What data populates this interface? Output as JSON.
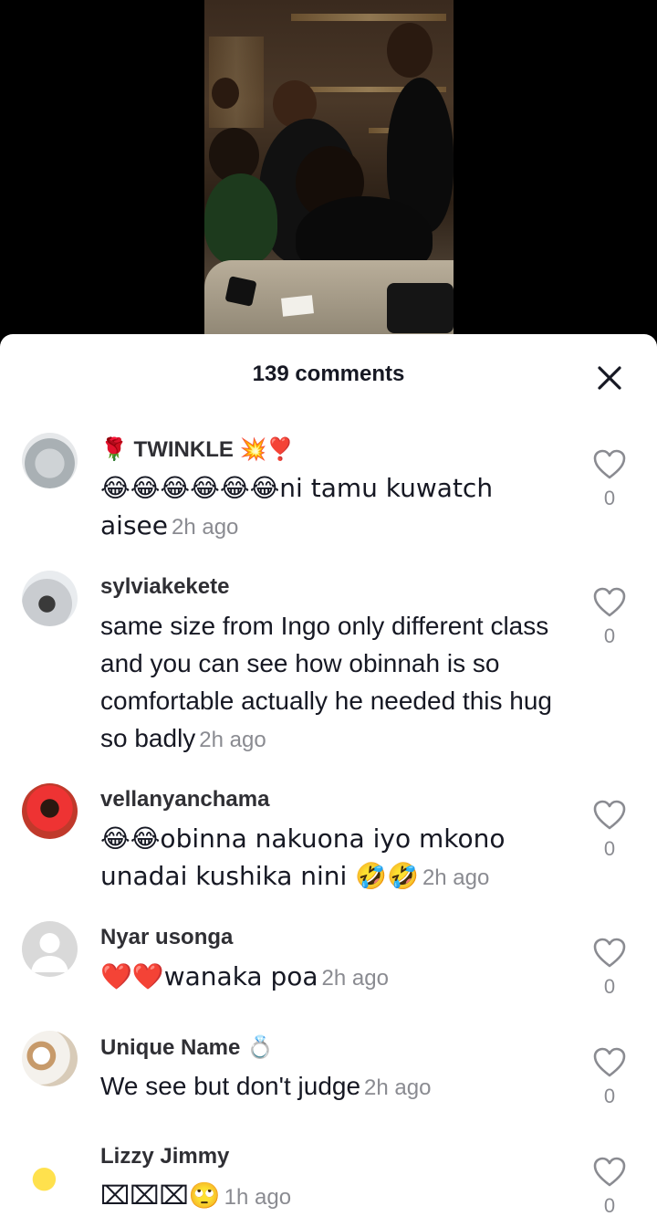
{
  "header": {
    "comment_count": "139 comments",
    "close_icon": "close-icon"
  },
  "comments": [
    {
      "username": "🌹 TWINKLE 💥❣️",
      "text": "😂😂😂😂😂😂ni tamu kuwatch aisee",
      "time": "2h ago",
      "likes": "0"
    },
    {
      "username": "sylviakekete",
      "text": "same size from Ingo only different class and you can see how obinnah is so comfortable actually he needed this hug so badly",
      "time": "2h ago",
      "likes": "0"
    },
    {
      "username": "vellanyanchama",
      "text": "😂😂obinna nakuona iyo mkono unadai kushika nini 🤣🤣",
      "time": "2h ago",
      "likes": "0"
    },
    {
      "username": "Nyar usonga",
      "text": "❤️❤️wanaka poa",
      "time": "2h ago",
      "likes": "0"
    },
    {
      "username": "Unique Name 💍",
      "text": "We see but don't judge",
      "time": "2h ago",
      "likes": "0"
    },
    {
      "username": "Lizzy Jimmy",
      "text": "⌧⌧⌧🙄",
      "time": "1h ago",
      "likes": "0"
    }
  ],
  "colors": {
    "sheet_bg": "#ffffff",
    "text_primary": "#161823",
    "text_secondary": "#8a8b91",
    "backdrop": "#000000"
  }
}
